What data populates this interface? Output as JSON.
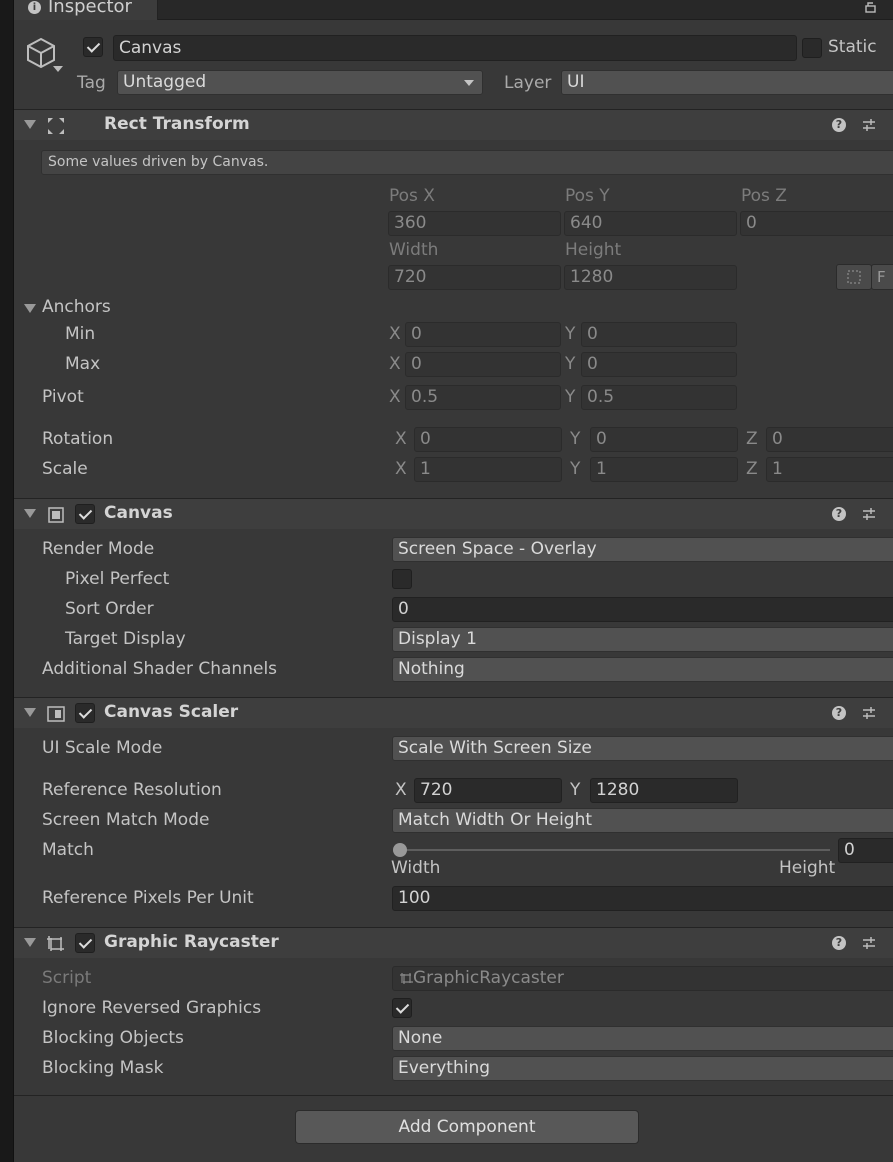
{
  "tab": {
    "title": "Inspector"
  },
  "object": {
    "active": true,
    "name": "Canvas",
    "static_label": "Static",
    "tag_label": "Tag",
    "tag_value": "Untagged",
    "layer_label": "Layer",
    "layer_value": "UI"
  },
  "rect_transform": {
    "title": "Rect Transform",
    "help_text": "Some values driven by Canvas.",
    "pos_x_label": "Pos X",
    "pos_x": "360",
    "pos_y_label": "Pos Y",
    "pos_y": "640",
    "pos_z_label": "Pos Z",
    "pos_z": "0",
    "width_label": "Width",
    "width": "720",
    "height_label": "Height",
    "height": "1280",
    "r_button": "F",
    "anchors_label": "Anchors",
    "min_label": "Min",
    "min_x": "0",
    "min_y": "0",
    "max_label": "Max",
    "max_x": "0",
    "max_y": "0",
    "pivot_label": "Pivot",
    "pivot_x": "0.5",
    "pivot_y": "0.5",
    "rotation_label": "Rotation",
    "rot_x": "0",
    "rot_y": "0",
    "rot_z": "0",
    "scale_label": "Scale",
    "scale_x": "1",
    "scale_y": "1",
    "scale_z": "1",
    "axis_x": "X",
    "axis_y": "Y",
    "axis_z": "Z"
  },
  "canvas": {
    "title": "Canvas",
    "enabled": true,
    "render_mode_label": "Render Mode",
    "render_mode": "Screen Space - Overlay",
    "pixel_perfect_label": "Pixel Perfect",
    "pixel_perfect": false,
    "sort_order_label": "Sort Order",
    "sort_order": "0",
    "target_display_label": "Target Display",
    "target_display": "Display 1",
    "shader_channels_label": "Additional Shader Channels",
    "shader_channels": "Nothing"
  },
  "canvas_scaler": {
    "title": "Canvas Scaler",
    "enabled": true,
    "ui_scale_mode_label": "UI Scale Mode",
    "ui_scale_mode": "Scale With Screen Size",
    "ref_res_label": "Reference Resolution",
    "ref_res_x": "720",
    "ref_res_y": "1280",
    "match_mode_label": "Screen Match Mode",
    "match_mode": "Match Width Or Height",
    "match_label": "Match",
    "match_value": "0",
    "match_fraction": 0,
    "match_left": "Width",
    "match_right": "Height",
    "ppu_label": "Reference Pixels Per Unit",
    "ppu": "100"
  },
  "graphic_raycaster": {
    "title": "Graphic Raycaster",
    "enabled": true,
    "script_label": "Script",
    "script": "GraphicRaycaster",
    "ignore_reversed_label": "Ignore Reversed Graphics",
    "ignore_reversed": true,
    "blocking_objects_label": "Blocking Objects",
    "blocking_objects": "None",
    "blocking_mask_label": "Blocking Mask",
    "blocking_mask": "Everything"
  },
  "add_component": "Add Component"
}
